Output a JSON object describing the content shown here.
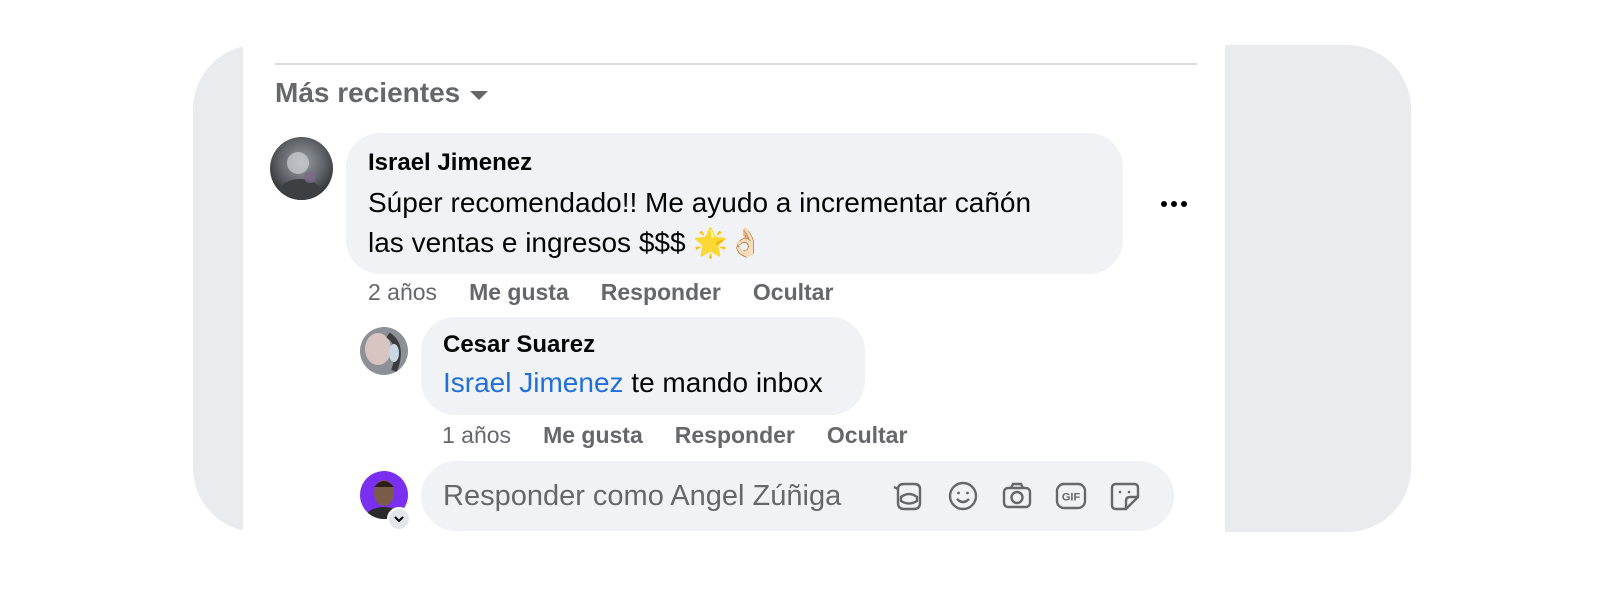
{
  "sort": {
    "label": "Más recientes",
    "icon": "caret-down-icon"
  },
  "comments": [
    {
      "author": "Israel Jimenez",
      "text_line1": "Súper recomendado!! Me ayudo a incrementar cañón",
      "text_line2": "las ventas e ingresos $$$ 🌟👌🏻",
      "time": "2 años",
      "actions": [
        "Me gusta",
        "Responder",
        "Ocultar"
      ]
    }
  ],
  "reply": {
    "author": "Cesar Suarez",
    "mention": "Israel Jimenez",
    "text": " te mando inbox",
    "time": "1 años",
    "actions": [
      "Me gusta",
      "Responder",
      "Ocultar"
    ]
  },
  "composer": {
    "placeholder": "Responder como Angel Zúñiga",
    "tools": [
      "avatar-sticker-icon",
      "emoji-icon",
      "camera-icon",
      "gif-icon",
      "sticker-icon"
    ],
    "gif_label": "GIF"
  },
  "colors": {
    "mention": "#216fdb",
    "bubble": "#f0f2f5",
    "secondary_text": "#65676b"
  }
}
